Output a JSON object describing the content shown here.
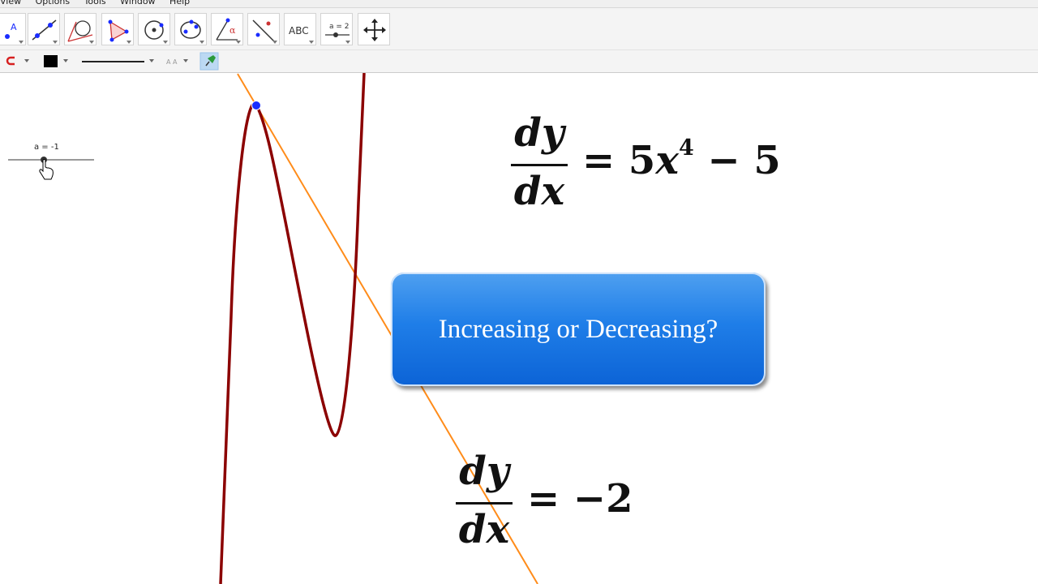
{
  "menubar": {
    "items": [
      "View",
      "Options",
      "Tools",
      "Window",
      "Help"
    ]
  },
  "toolbar": {
    "tools": [
      {
        "name": "move-tool-icon"
      },
      {
        "name": "line-tool-icon"
      },
      {
        "name": "perpendicular-tool-icon"
      },
      {
        "name": "polygon-tool-icon"
      },
      {
        "name": "circle-tool-icon"
      },
      {
        "name": "ellipse-tool-icon"
      },
      {
        "name": "angle-tool-icon"
      },
      {
        "name": "reflect-tool-icon"
      },
      {
        "name": "text-tool-icon",
        "label": "ABC"
      },
      {
        "name": "slider-tool-icon",
        "label": "a = 2"
      },
      {
        "name": "move-graphics-view-icon"
      }
    ]
  },
  "stylebar": {
    "color_swatch": "#000000",
    "text_size_label": "A A"
  },
  "graphics": {
    "slider": {
      "label": "a = -1"
    },
    "curve_color": "#8b0000",
    "tangent_color": "#ff8c1a",
    "point_color": "#1a2cff"
  },
  "equation_top": {
    "numerator": "dy",
    "denominator": "dx",
    "rhs_prefix": "= 5",
    "rhs_var": "x",
    "rhs_exp": "4",
    "rhs_suffix": " − 5"
  },
  "equation_bottom": {
    "numerator": "dy",
    "denominator": "dx",
    "rhs": "= −2"
  },
  "callout": {
    "text": "Increasing or Decreasing?",
    "color_top": "#4fa0f0",
    "color_bottom": "#0c63d6"
  }
}
